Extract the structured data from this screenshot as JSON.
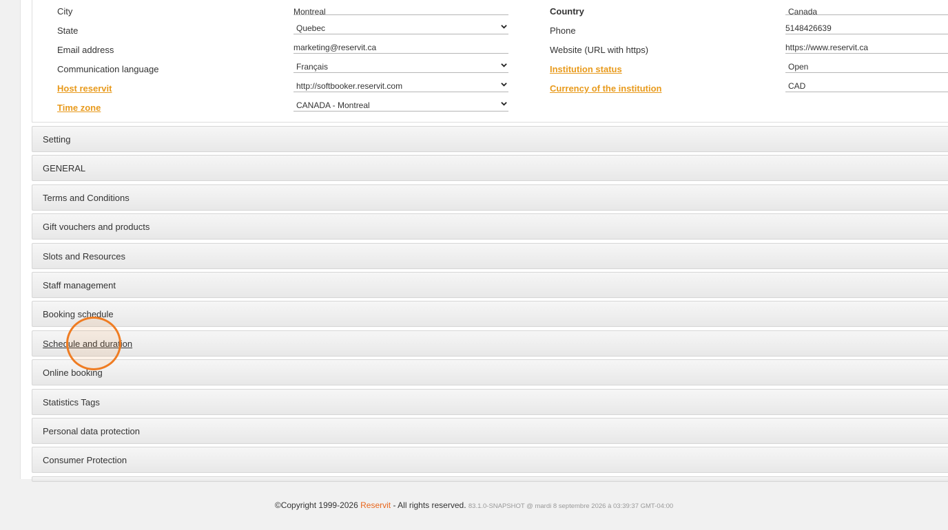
{
  "address": {
    "left": [
      {
        "label": "City",
        "value": "Montreal",
        "type": "text"
      },
      {
        "label": "State",
        "value": "Quebec",
        "type": "select"
      },
      {
        "label": "Email address",
        "value": "marketing@reservit.ca",
        "type": "text"
      },
      {
        "label": "Communication language",
        "value": "Français",
        "type": "select"
      },
      {
        "label": "Host reservit",
        "value": "http://softbooker.reservit.com",
        "type": "select"
      },
      {
        "label": "Time zone",
        "value": "CANADA - Montreal",
        "type": "select"
      }
    ],
    "right": [
      {
        "label": "Country",
        "value": "Canada"
      },
      {
        "label": "Phone",
        "value": "5148426639"
      },
      {
        "label": "Website (URL with https)",
        "value": "https://www.reservit.ca"
      },
      {
        "label": "Institution status",
        "value": "Open"
      },
      {
        "label": "Currency of the institution",
        "value": "CAD"
      }
    ]
  },
  "sections": [
    "Setting",
    "GENERAL",
    "Terms and Conditions",
    "Gift vouchers and products",
    "Slots and Resources",
    "Staff management",
    "Booking schedule",
    "Schedule and duration",
    "Online booking",
    "Statistics Tags",
    "Personal data protection",
    "Consumer Protection"
  ],
  "footer": {
    "copyright": "©Copyright 1999-2026",
    "brand": "Reservit",
    "rights": "- All rights reserved.",
    "version": "83.1.0-SNAPSHOT @ mardi 8 septembre 2026 à 03:39:37 GMT-04:00"
  },
  "colors": {
    "link": "#e89a1c",
    "brand": "#e8661c",
    "cursor_ring": "#ef7c22",
    "section_bg": "#ececec"
  }
}
